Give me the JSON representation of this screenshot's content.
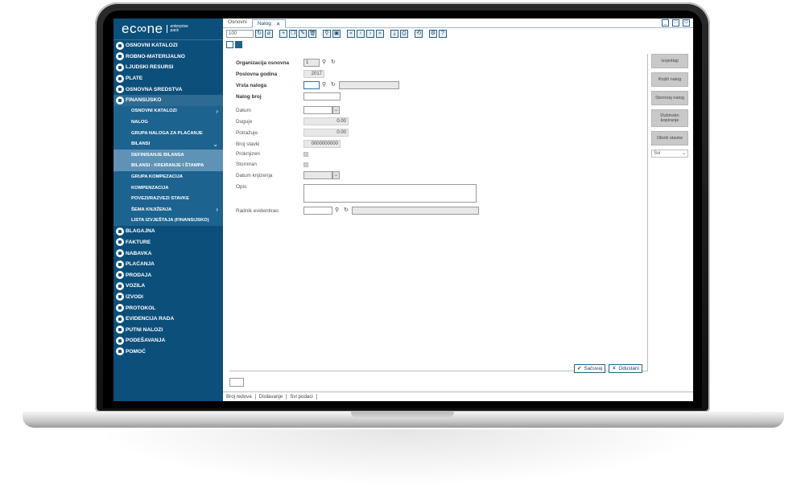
{
  "app": {
    "logo": "ec∞ne",
    "logo_sub_1": "enterprise",
    "logo_sub_2": "pack"
  },
  "sidebar": {
    "items": [
      {
        "label": "OSNOVNI KATALOZI"
      },
      {
        "label": "ROBNO-MATERIJALNO"
      },
      {
        "label": "LJUDSKI RESURSI"
      },
      {
        "label": "PLATE"
      },
      {
        "label": "OSNOVNA SREDSTVA"
      },
      {
        "label": "FINANSIJSKO"
      }
    ],
    "finansijsko_sub": [
      {
        "label": "OSNOVNI KATALOZI",
        "chevron": "›"
      },
      {
        "label": "NALOG",
        "chevron": ""
      },
      {
        "label": "GRUPA NALOGA ZA PLAĆANJE",
        "chevron": ""
      },
      {
        "label": "BILANSI",
        "chevron": "⌄"
      },
      {
        "label": "DEFINISANJE BILANSA",
        "chevron": ""
      },
      {
        "label": "BILANSI - KREIRANJE I ŠTAMPA",
        "chevron": ""
      },
      {
        "label": "GRUPA KOMPEZACIJA",
        "chevron": ""
      },
      {
        "label": "KOMPENZACIJA",
        "chevron": ""
      },
      {
        "label": "POVEZI/RAZVEZI STAVKE",
        "chevron": ""
      },
      {
        "label": "ŠEMA KNJIŽENJA",
        "chevron": "›"
      },
      {
        "label": "LISTA IZVJEŠTAJA (FINANSIJSKO)",
        "chevron": ""
      }
    ],
    "items_after": [
      {
        "label": "BLAGAJNA"
      },
      {
        "label": "FAKTURE"
      },
      {
        "label": "NABAVKA"
      },
      {
        "label": "PLAĆANJA"
      },
      {
        "label": "PRODAJA"
      },
      {
        "label": "VOZILA"
      },
      {
        "label": "IZVODI"
      },
      {
        "label": "PROTOKOL"
      },
      {
        "label": "EVIDENCIJA RADA"
      },
      {
        "label": "PUTNI NALOZI"
      },
      {
        "label": "PODEŠAVANJA"
      },
      {
        "label": "POMOĆ"
      }
    ]
  },
  "tabs": {
    "tab1": "Osnovni",
    "tab2": "Nalog",
    "close": "✕"
  },
  "toolbar": {
    "page_size": "100"
  },
  "form": {
    "org_label": "Organizacija osnovna",
    "org_value": "1",
    "year_label": "Poslovna godina",
    "year_value": "2017",
    "vrsta_label": "Vrsta naloga",
    "nalog_broj_label": "Nalog broj",
    "datum_label": "Datum",
    "duguje_label": "Duguje",
    "duguje_value": "0.00",
    "potrazuje_label": "Potražuje",
    "potrazuje_value": "0.00",
    "broj_stavki_label": "Broj stavki",
    "broj_stavki_value": "0000000000",
    "proknjizen_label": "Proknjizen",
    "storniran_label": "Storniran",
    "datum_knjizenja_label": "Datum knjizenja",
    "opis_label": "Opis",
    "radnik_label": "Radnik evidentirao"
  },
  "right_panel": {
    "btn1": "Izvještaji",
    "btn2": "Knjiži nalog",
    "btn3": "Storniraj nalog",
    "btn4": "Dubinsko kopiranje",
    "btn5": "Obriši stavke",
    "select": "Svi"
  },
  "actions": {
    "save": "Sačuvaj",
    "cancel": "Odustani"
  },
  "status": {
    "s1": "Broj redova",
    "s2": "Dodavanje",
    "s3": "Svi podaci"
  }
}
